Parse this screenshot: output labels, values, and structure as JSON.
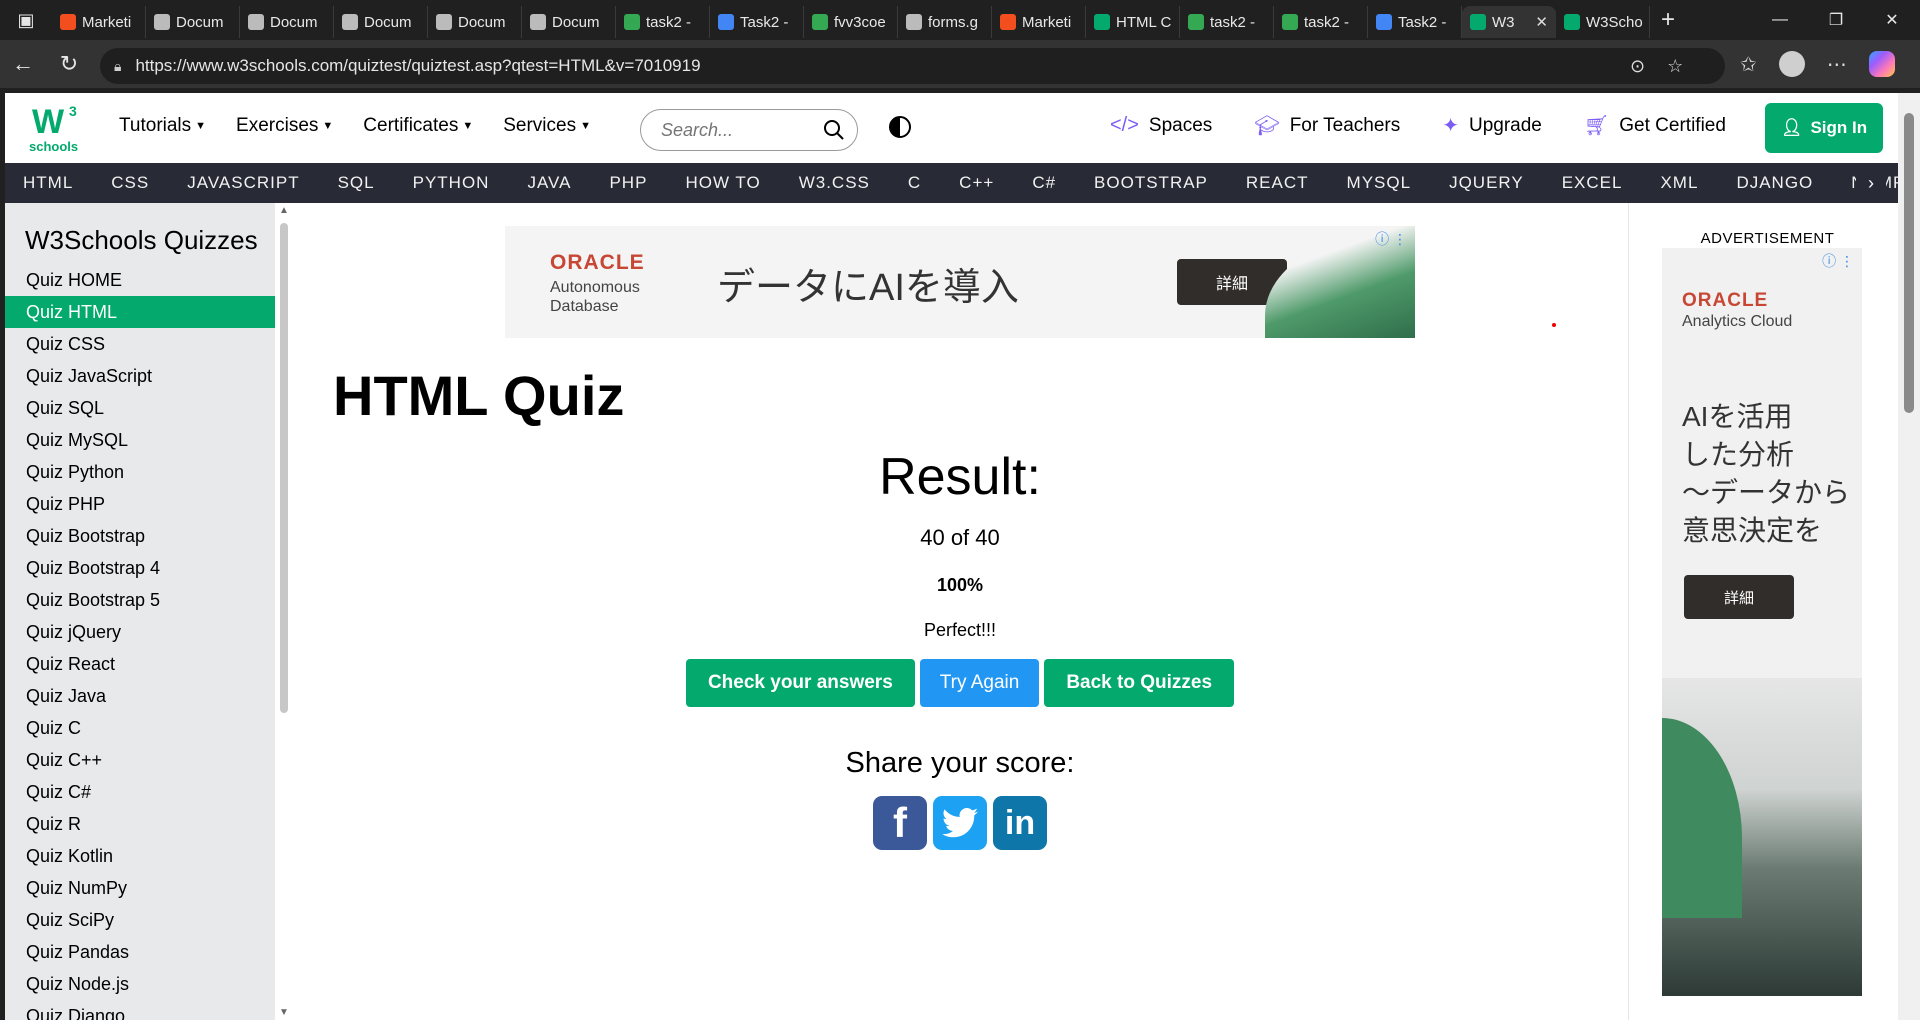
{
  "browser": {
    "tabs": [
      {
        "title": "Marketi",
        "icon": "figma-icon",
        "color": "#f24e1e"
      },
      {
        "title": "Docum",
        "icon": "globe-icon",
        "color": "#bbbbbb"
      },
      {
        "title": "Docum",
        "icon": "globe-icon",
        "color": "#bbbbbb"
      },
      {
        "title": "Docum",
        "icon": "globe-icon",
        "color": "#bbbbbb"
      },
      {
        "title": "Docum",
        "icon": "globe-icon",
        "color": "#bbbbbb"
      },
      {
        "title": "Docum",
        "icon": "globe-icon",
        "color": "#bbbbbb"
      },
      {
        "title": "task2 - ",
        "icon": "drive-icon",
        "color": "#34a853"
      },
      {
        "title": "Task2 - ",
        "icon": "docs-icon",
        "color": "#4285f4"
      },
      {
        "title": "fvv3coe",
        "icon": "drive-icon",
        "color": "#34a853"
      },
      {
        "title": "forms.g",
        "icon": "page-icon",
        "color": "#bbbbbb"
      },
      {
        "title": "Marketi",
        "icon": "figma-icon",
        "color": "#f24e1e"
      },
      {
        "title": "HTML C",
        "icon": "w3schools-icon",
        "color": "#04aa6d"
      },
      {
        "title": "task2 - ",
        "icon": "drive-icon",
        "color": "#34a853"
      },
      {
        "title": "task2 - ",
        "icon": "drive-icon",
        "color": "#34a853"
      },
      {
        "title": "Task2 - ",
        "icon": "docs-icon",
        "color": "#4285f4"
      },
      {
        "title": "W3",
        "icon": "w3schools-icon",
        "color": "#04aa6d",
        "active": true
      },
      {
        "title": "W3Scho",
        "icon": "w3schools-icon",
        "color": "#04aa6d"
      }
    ],
    "url": "https://www.w3schools.com/quiztest/quiztest.asp?qtest=HTML&v=7010919"
  },
  "topnav": {
    "logo_w": "W",
    "logo_sup": "3",
    "logo_text": "schools",
    "menu": [
      "Tutorials",
      "Exercises",
      "Certificates",
      "Services"
    ],
    "search_placeholder": "Search...",
    "right": [
      "Spaces",
      "For Teachers",
      "Upgrade",
      "Get Certified"
    ],
    "signin": "Sign In"
  },
  "langbar": [
    "HTML",
    "CSS",
    "JAVASCRIPT",
    "SQL",
    "PYTHON",
    "JAVA",
    "PHP",
    "HOW TO",
    "W3.CSS",
    "C",
    "C++",
    "C#",
    "BOOTSTRAP",
    "REACT",
    "MYSQL",
    "JQUERY",
    "EXCEL",
    "XML",
    "DJANGO",
    "NUMP"
  ],
  "sidebar": {
    "title": "W3Schools Quizzes",
    "items": [
      "Quiz HOME",
      "Quiz HTML",
      "Quiz CSS",
      "Quiz JavaScript",
      "Quiz SQL",
      "Quiz MySQL",
      "Quiz Python",
      "Quiz PHP",
      "Quiz Bootstrap",
      "Quiz Bootstrap 4",
      "Quiz Bootstrap 5",
      "Quiz jQuery",
      "Quiz React",
      "Quiz Java",
      "Quiz C",
      "Quiz C++",
      "Quiz C#",
      "Quiz R",
      "Quiz Kotlin",
      "Quiz NumPy",
      "Quiz SciPy",
      "Quiz Pandas",
      "Quiz Node.js",
      "Quiz Django"
    ],
    "active_index": 1
  },
  "ad_top": {
    "brand": "ORACLE",
    "product": "Autonomous Database",
    "headline": "データにAIを導入",
    "button": "詳細"
  },
  "main": {
    "title": "HTML Quiz",
    "result_heading": "Result:",
    "score": "40 of 40",
    "percent": "100%",
    "verdict": "Perfect!!!",
    "buttons": {
      "check": "Check your answers",
      "try_again": "Try Again",
      "back": "Back to Quizzes"
    },
    "share_heading": "Share your score:",
    "social": {
      "facebook": "f",
      "twitter": "t",
      "linkedin": "in"
    }
  },
  "ad_side": {
    "label": "ADVERTISEMENT",
    "brand": "ORACLE",
    "product": "Analytics Cloud",
    "headline_lines": [
      "AIを活用",
      "した分析",
      "〜データから",
      "意思決定を"
    ],
    "button": "詳細"
  }
}
